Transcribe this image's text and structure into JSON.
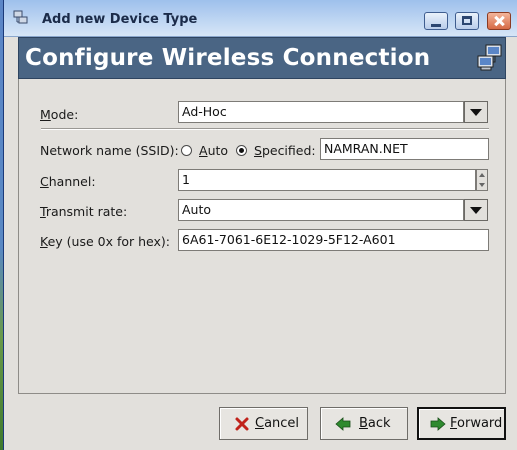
{
  "window": {
    "title": "Add new Device Type",
    "controls": {
      "minimize": "minimize",
      "maximize": "maximize",
      "close": "close"
    }
  },
  "banner": {
    "title": "Configure Wireless Connection",
    "icon": "network-computers-icon"
  },
  "form": {
    "mode": {
      "label_accel": "M",
      "label_rest": "ode:",
      "value": "Ad-Hoc"
    },
    "ssid": {
      "label": "Network name (SSID):",
      "auto_accel": "A",
      "auto_rest": "uto",
      "specified_accel": "S",
      "specified_rest": "pecified:",
      "selected": "specified",
      "value": "NAMRAN.NET"
    },
    "channel": {
      "label_accel": "C",
      "label_rest": "hannel:",
      "value": "1"
    },
    "rate": {
      "label_accel": "T",
      "label_rest": "ransmit rate:",
      "value": "Auto"
    },
    "key": {
      "label_accel": "K",
      "label_rest": "ey (use 0x for hex):",
      "value": "6A61-7061-6E12-1029-5F12-A601"
    }
  },
  "buttons": {
    "cancel": {
      "accel": "C",
      "rest": "ancel"
    },
    "back": {
      "accel": "B",
      "rest": "ack"
    },
    "forward": {
      "accel": "F",
      "rest": "orward"
    }
  },
  "colors": {
    "banner": "#4a6584",
    "titlebar": "#9ec0ec",
    "cancel_icon": "#c0221a",
    "arrow_icon": "#2f8a2f"
  }
}
